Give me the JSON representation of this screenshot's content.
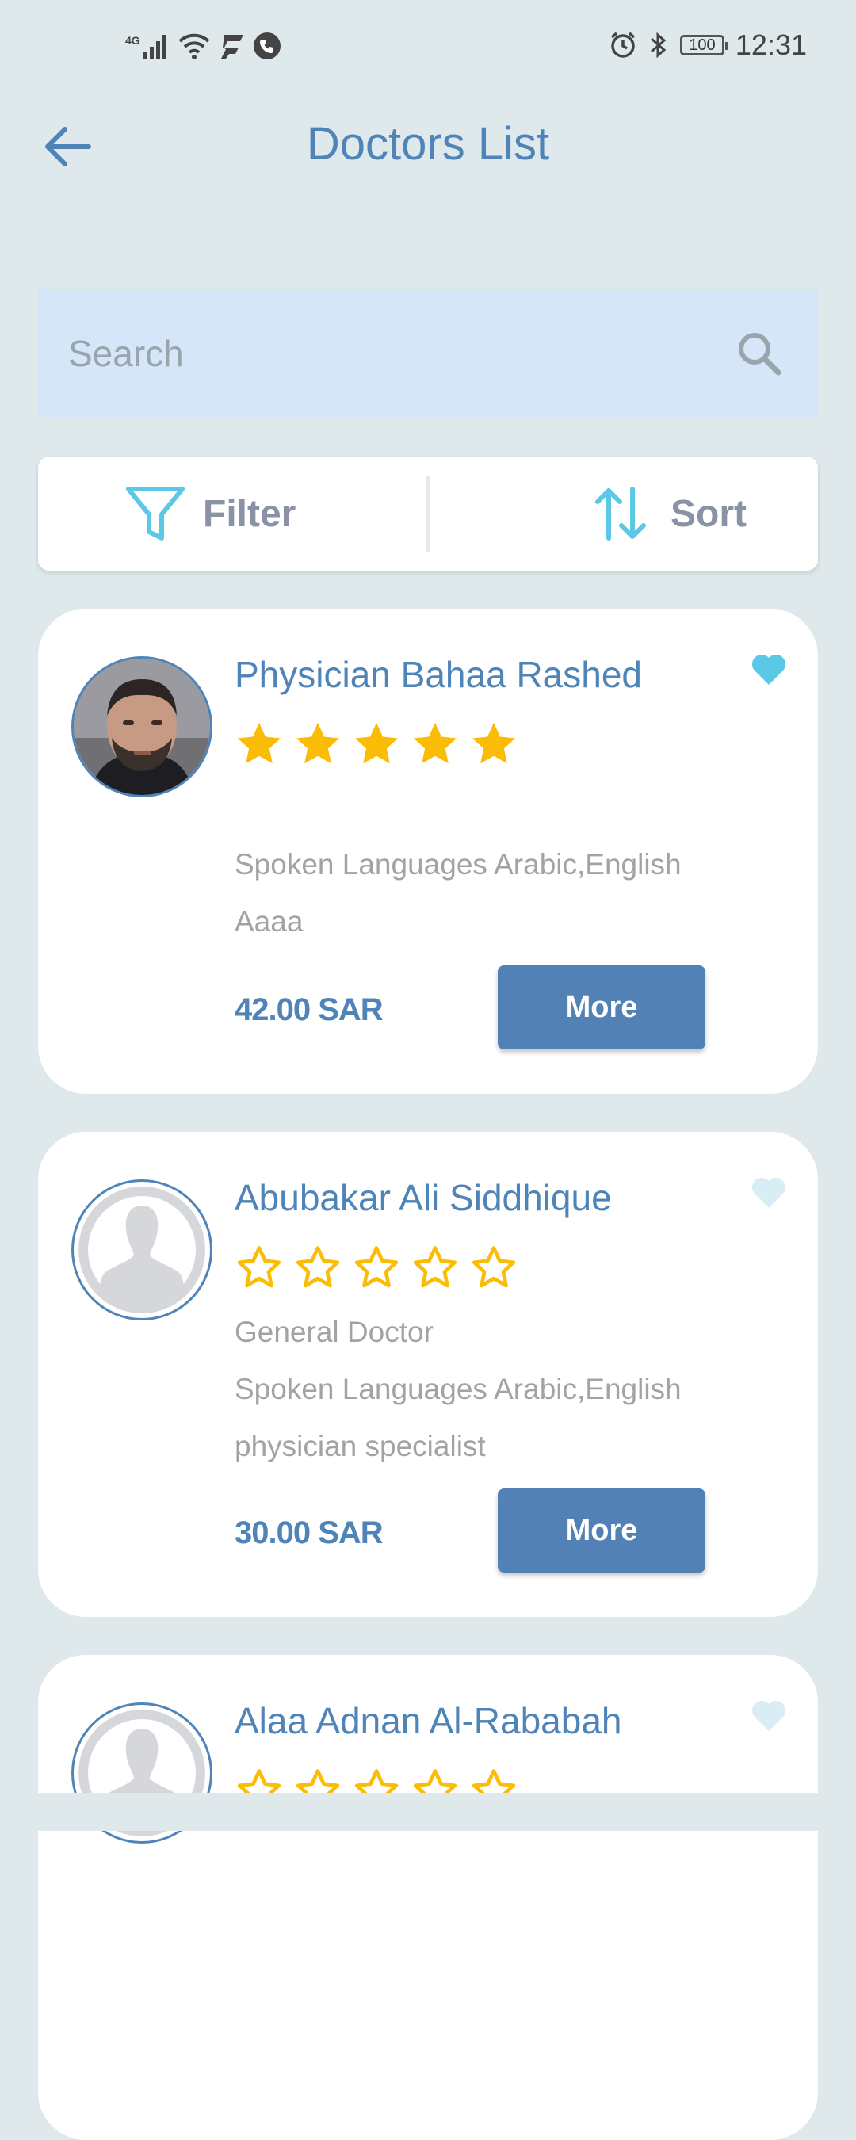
{
  "status_bar": {
    "network": "4G",
    "battery": "100",
    "time": "12:31"
  },
  "header": {
    "title": "Doctors List",
    "back_icon": "arrow-left-icon"
  },
  "search": {
    "placeholder": "Search",
    "value": ""
  },
  "toolbar": {
    "filter_label": "Filter",
    "sort_label": "Sort"
  },
  "doctors": [
    {
      "name": "Physician Bahaa Rashed",
      "rating": 5,
      "favorite": true,
      "specialty": "",
      "languages": "Spoken Languages Arabic,English",
      "description": "Aaaa",
      "price": "42.00 SAR",
      "more_label": "More"
    },
    {
      "name": "Abubakar Ali Siddhique",
      "rating": 0,
      "favorite": false,
      "specialty": "General Doctor",
      "languages": "Spoken Languages Arabic,English",
      "description": "physician specialist",
      "price": "30.00 SAR",
      "more_label": "More"
    },
    {
      "name": "Alaa Adnan Al-Rababah",
      "rating": 0,
      "favorite": false
    }
  ],
  "colors": {
    "background": "#dfe9ec",
    "primary": "#4f84b8",
    "button": "#5281b5",
    "accent": "#5bc8e6",
    "star": "#fbbc05",
    "search_bg": "#d4e6f7"
  }
}
